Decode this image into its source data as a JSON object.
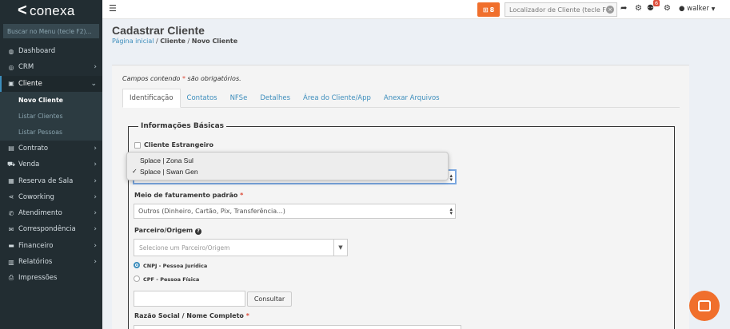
{
  "brand": {
    "name": "conexa"
  },
  "sidebar": {
    "search_placeholder": "Buscar no Menu (tecle F2)...",
    "items": [
      {
        "label": "Dashboard",
        "icon": "dashboard-icon",
        "glyph": "◍",
        "chev": false
      },
      {
        "label": "CRM",
        "icon": "crm-icon",
        "glyph": "◎",
        "chev": true
      },
      {
        "label": "Cliente",
        "icon": "client-card-icon",
        "glyph": "▣",
        "chev": true,
        "active": true
      }
    ],
    "subitems": [
      {
        "label": "Novo Cliente",
        "current": true
      },
      {
        "label": "Listar Clientes"
      },
      {
        "label": "Listar Pessoas"
      }
    ],
    "items2": [
      {
        "label": "Contrato",
        "icon": "contract-icon",
        "glyph": "▤",
        "chev": true
      },
      {
        "label": "Venda",
        "icon": "cart-icon",
        "glyph": "⛟",
        "chev": true
      },
      {
        "label": "Reserva de Sala",
        "icon": "calendar-icon",
        "glyph": "▦",
        "chev": true
      },
      {
        "label": "Coworking",
        "icon": "share-icon",
        "glyph": "⋖",
        "chev": true
      },
      {
        "label": "Atendimento",
        "icon": "phone-icon",
        "glyph": "✆",
        "chev": true
      },
      {
        "label": "Correspondência",
        "icon": "mail-icon",
        "glyph": "✉",
        "chev": true
      },
      {
        "label": "Financeiro",
        "icon": "money-icon",
        "glyph": "▬",
        "chev": true
      },
      {
        "label": "Relatórios",
        "icon": "chart-icon",
        "glyph": "▥",
        "chev": true
      },
      {
        "label": "Impressões",
        "icon": "print-icon",
        "glyph": "⎙",
        "chev": false
      }
    ]
  },
  "topbar": {
    "gift_count": "8",
    "locator_placeholder": "Localizador de Cliente (tecle F4)",
    "notif_count": "6",
    "user_name": "walker"
  },
  "page": {
    "title": "Cadastrar Cliente",
    "breadcrumb_home": "Página inicial",
    "breadcrumb_sep1": " / ",
    "breadcrumb_mid": "Cliente",
    "breadcrumb_sep2": " / ",
    "breadcrumb_current": "Novo Cliente"
  },
  "form": {
    "required_note_pre": "Campos contendo ",
    "required_star": "*",
    "required_note_post": " são obrigatórios.",
    "tabs": [
      "Identificação",
      "Contatos",
      "NFSe",
      "Detalhes",
      "Área do Cliente/App",
      "Anexar Arquivos"
    ],
    "legend": "Informações Básicas",
    "foreign_client_label": "Cliente Estrangeiro",
    "billing_label": "Meio de faturamento padrão",
    "billing_value": "Outros (Dinheiro, Cartão, Pix, Transferência...)",
    "partner_label": "Parceiro/Origem",
    "partner_placeholder": "Selecione um Parceiro/Origem",
    "radio_cnpj": "CNPJ - Pessoa Jurídica",
    "radio_cpf": "CPF - Pessoa Física",
    "consult_button": "Consultar",
    "company_label": "Razão Social / Nome Completo"
  },
  "dropdown": {
    "options": [
      "Splace | Zona Sul",
      "Splace | Swan Gen"
    ],
    "selected_index": 1,
    "check": "✓"
  }
}
